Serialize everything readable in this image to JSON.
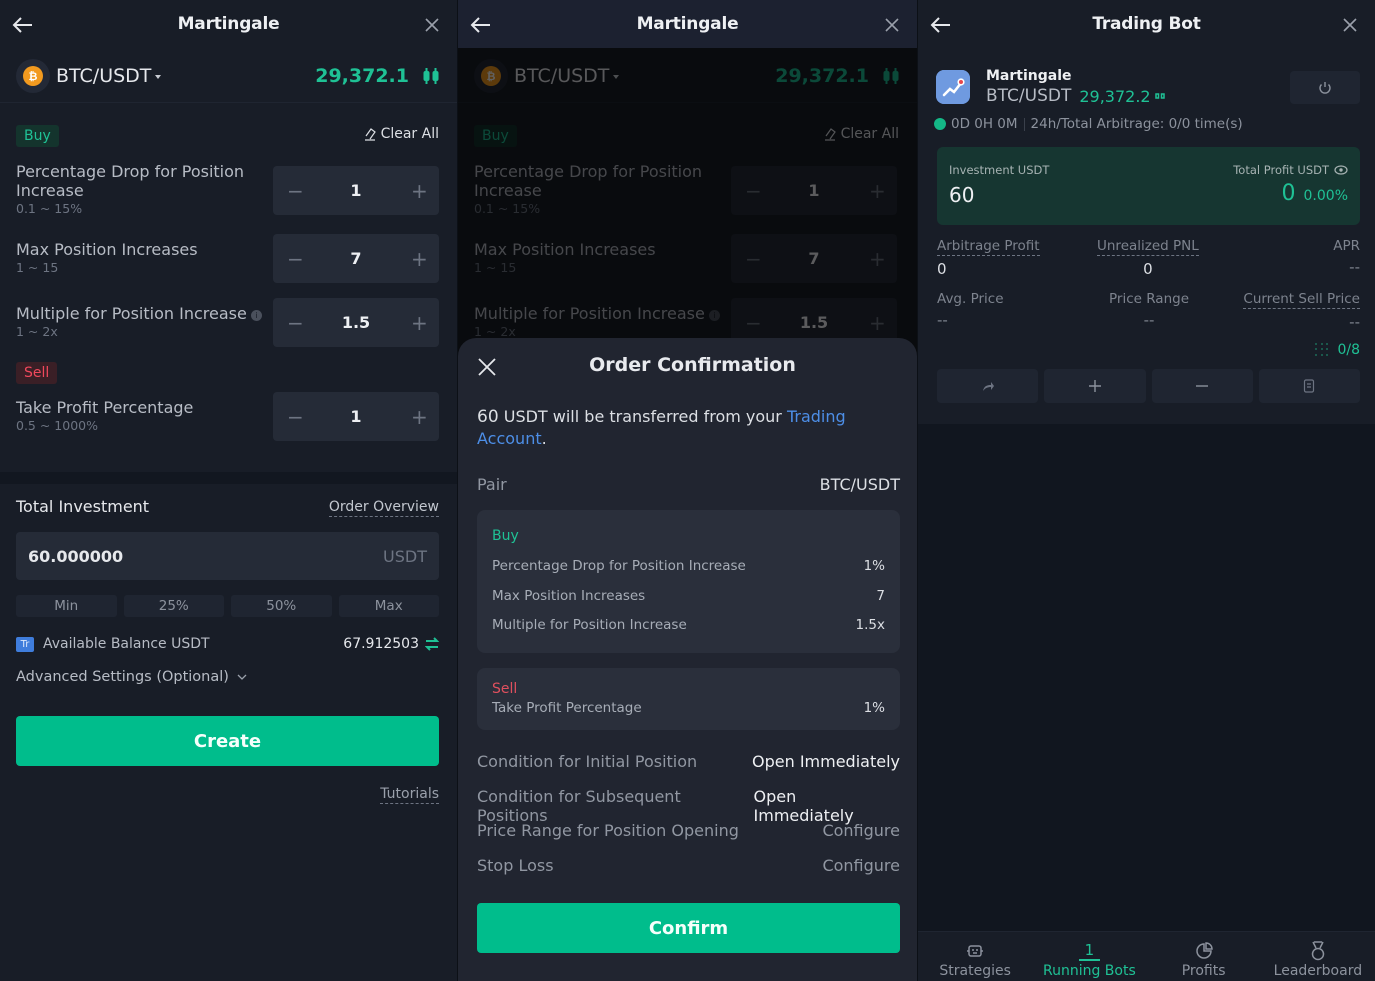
{
  "colors": {
    "accent_green": "#1fc195",
    "button_green": "#00bd8c",
    "sell_red": "#f0485c",
    "link_blue": "#4d8ee6",
    "background": "#181d27"
  },
  "create_screen": {
    "header": {
      "title": "Martingale",
      "back_icon": "arrow-left-icon",
      "close_icon": "close-icon"
    },
    "pair": {
      "name": "BTC/USDT",
      "price": "29,372.1",
      "coin_symbol": "₿"
    },
    "buy_tag": "Buy",
    "clear_all": "Clear All",
    "params": [
      {
        "label": "Percentage Drop for Position Increase",
        "range": "0.1 ~ 15%",
        "value": "1"
      },
      {
        "label": "Max Position Increases",
        "range": "1 ~ 15",
        "value": "7"
      },
      {
        "label": "Multiple for Position Increase",
        "range": "1 ~ 2x",
        "value": "1.5"
      }
    ],
    "sell_tag": "Sell",
    "sell_params": [
      {
        "label": "Take Profit Percentage",
        "range": "0.5 ~ 1000%",
        "value": "1"
      }
    ],
    "stepper_minus": "−",
    "stepper_plus": "+",
    "total_investment": {
      "title": "Total Investment",
      "order_overview": "Order Overview",
      "value": "60.000000",
      "unit": "USDT",
      "presets": [
        "Min",
        "25%",
        "50%",
        "Max"
      ]
    },
    "available": {
      "badge": "Tr",
      "label": "Available Balance USDT",
      "amount": "67.912503"
    },
    "advanced_settings": "Advanced Settings (Optional)",
    "create_button": "Create",
    "tutorials": "Tutorials"
  },
  "confirm_screen": {
    "header": {
      "title": "Martingale"
    },
    "background": {
      "pair": "BTC/USDT",
      "price": "29,372.1",
      "buy_tag": "Buy",
      "clear_all": "Clear All",
      "params": [
        {
          "label": "Percentage Drop for Position",
          "label2": "Increase",
          "range": "0.1 ~ 15%",
          "value": "1"
        },
        {
          "label": "Max Position Increases",
          "range": "1 ~ 15",
          "value": "7"
        },
        {
          "label": "Multiple for Position Increase",
          "range": "1 ~ 2x",
          "value": "1.5"
        }
      ]
    },
    "sheet": {
      "title": "Order Confirmation",
      "amount": "60",
      "notice_text": " USDT will be transferred from your ",
      "notice_link": "Trading Account",
      "notice_end": ".",
      "pair_label": "Pair",
      "pair_value": "BTC/USDT",
      "buy_card": {
        "title": "Buy",
        "rows": [
          {
            "label": "Percentage Drop for Position Increase",
            "value": "1%"
          },
          {
            "label": "Max Position Increases",
            "value": "7"
          },
          {
            "label": "Multiple for Position Increase",
            "value": "1.5x"
          }
        ]
      },
      "sell_card": {
        "title": "Sell",
        "rows": [
          {
            "label": "Take Profit Percentage",
            "value": "1%"
          }
        ]
      },
      "conditions": [
        {
          "label": "Condition for Initial Position",
          "value": "Open Immediately"
        },
        {
          "label": "Condition for Subsequent Positions",
          "value": "Open Immediately"
        },
        {
          "label": "Price Range for Position Opening",
          "value": "Configure"
        },
        {
          "label": "Stop Loss",
          "value": "Configure"
        }
      ],
      "confirm_button": "Confirm"
    }
  },
  "bot_screen": {
    "header": {
      "title": "Trading Bot"
    },
    "bot": {
      "name": "Martingale",
      "pair": "BTC/USDT",
      "price": "29,372.2"
    },
    "runtime": "0D 0H 0M",
    "arbitrage": "24h/Total Arbitrage: 0/0 time(s)",
    "investment_label": "Investment USDT",
    "investment_value": "60",
    "total_profit_label": "Total Profit USDT",
    "total_profit_value": "0",
    "total_profit_pct": "0.00%",
    "stats": [
      {
        "label": "Arbitrage Profit",
        "value": "0"
      },
      {
        "label": "Unrealized PNL",
        "value": "0"
      },
      {
        "label": "APR",
        "value": "--"
      },
      {
        "label": "Avg. Price",
        "value": "--"
      },
      {
        "label": "Price Range",
        "value": "--"
      },
      {
        "label": "Current Sell Price",
        "value": "--"
      }
    ],
    "grid_count": "0/8",
    "actions": [
      "share-icon",
      "plus-icon",
      "minus-icon",
      "document-icon"
    ],
    "tabs": [
      {
        "label": "Strategies",
        "icon": "robot-icon"
      },
      {
        "label": "Running Bots",
        "count": "1"
      },
      {
        "label": "Profits",
        "icon": "pie-chart-icon"
      },
      {
        "label": "Leaderboard",
        "icon": "medal-icon"
      }
    ]
  }
}
